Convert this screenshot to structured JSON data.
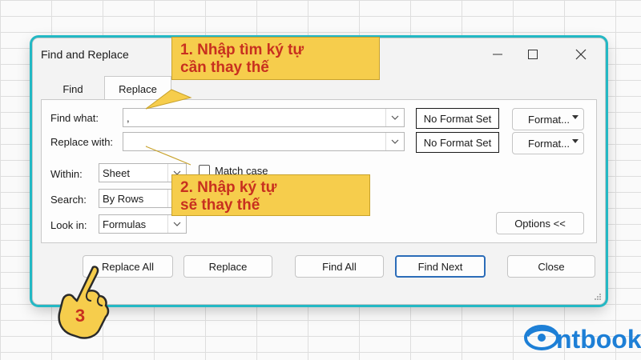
{
  "window": {
    "title": "Find and Replace"
  },
  "tabs": [
    {
      "label": "Find",
      "active": false
    },
    {
      "label": "Replace",
      "active": true
    }
  ],
  "find": {
    "label": "Find what:",
    "value": ",",
    "format_status": "No Format Set",
    "format_button": "Format..."
  },
  "replace": {
    "label": "Replace with:",
    "value": "",
    "format_status": "No Format Set",
    "format_button": "Format..."
  },
  "options": {
    "within_label": "Within:",
    "within_value": "Sheet",
    "search_label": "Search:",
    "search_value": "By Rows",
    "lookin_label": "Look in:",
    "lookin_value": "Formulas",
    "match_case_label": "Match case",
    "match_case_checked": false,
    "options_button": "Options <<"
  },
  "buttons": {
    "replace_all": "Replace All",
    "replace": "Replace",
    "find_all": "Find All",
    "find_next": "Find Next",
    "close": "Close"
  },
  "annotations": {
    "callout_1_line1": "1. Nhập tìm ký tự",
    "callout_1_line2": "cần thay thế",
    "callout_2_line1": "2. Nhập ký tự",
    "callout_2_line2": "sẽ thay thế",
    "step_number": "3"
  },
  "brand": {
    "logo_text": "ntbook"
  },
  "colors": {
    "accent_border": "#23b8c4",
    "callout_fill": "#f6cd4c",
    "callout_text": "#c8301f",
    "primary_button_border": "#2b6cb8",
    "hand_fill": "#f6cd4c",
    "brand_blue": "#1d7fd6"
  },
  "icons": {
    "minimize": "minimize-icon",
    "maximize": "maximize-icon",
    "close": "close-icon",
    "dropdown": "chevron-down-icon",
    "hand": "pointing-hand-icon"
  }
}
